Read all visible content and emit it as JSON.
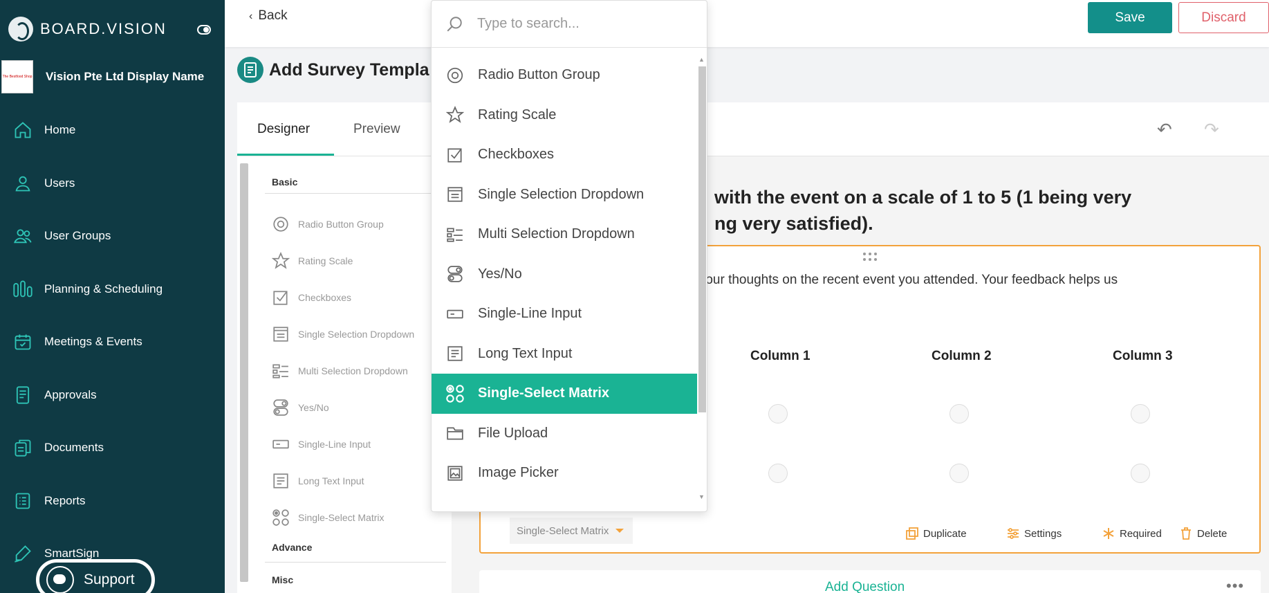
{
  "brand": {
    "name": "BOARD.VISION"
  },
  "organization": {
    "name": "Vision Pte Ltd Display Name",
    "logo_text": "The Bestfood Shop"
  },
  "sidebar": {
    "items": [
      {
        "label": "Home",
        "icon": "home-icon"
      },
      {
        "label": "Users",
        "icon": "user-icon"
      },
      {
        "label": "User Groups",
        "icon": "users-icon"
      },
      {
        "label": "Planning & Scheduling",
        "icon": "bars-icon"
      },
      {
        "label": "Meetings & Events",
        "icon": "calendar-icon"
      },
      {
        "label": "Approvals",
        "icon": "approval-doc-icon"
      },
      {
        "label": "Documents",
        "icon": "documents-icon"
      },
      {
        "label": "Reports",
        "icon": "report-icon"
      },
      {
        "label": "SmartSign",
        "icon": "pen-icon"
      }
    ],
    "support_label": "Support"
  },
  "toolbar": {
    "back_label": "Back",
    "save_label": "Save",
    "discard_label": "Discard"
  },
  "page": {
    "title": "Add Survey Templa"
  },
  "tabs": [
    {
      "label": "Designer"
    },
    {
      "label": "Preview"
    }
  ],
  "toolbox": {
    "basic_heading": "Basic",
    "advance_heading": "Advance",
    "misc_heading": "Misc",
    "items": [
      "Radio Button Group",
      "Rating Scale",
      "Checkboxes",
      "Single Selection Dropdown",
      "Multi Selection Dropdown",
      "Yes/No",
      "Single-Line Input",
      "Long Text Input",
      "Single-Select Matrix"
    ]
  },
  "question": {
    "title_line1": "with the event on a scale of 1 to 5 (1 being very",
    "title_line2": "ng very satisfied).",
    "description": "e your thoughts on the recent event you attended. Your feedback helps us",
    "columns": [
      "Column 1",
      "Column 2",
      "Column 3"
    ],
    "type_label": "Single-Select Matrix",
    "actions": {
      "duplicate": "Duplicate",
      "settings": "Settings",
      "required": "Required",
      "delete": "Delete"
    },
    "add_question_label": "Add Question",
    "more_label": "•••"
  },
  "dropdown": {
    "search_placeholder": "Type to search...",
    "items": [
      {
        "label": "Radio Button Group",
        "icon": "radio-icon"
      },
      {
        "label": "Rating Scale",
        "icon": "star-icon"
      },
      {
        "label": "Checkboxes",
        "icon": "checkbox-icon"
      },
      {
        "label": "Single Selection Dropdown",
        "icon": "dropdown-icon"
      },
      {
        "label": "Multi Selection Dropdown",
        "icon": "multi-dropdown-icon"
      },
      {
        "label": "Yes/No",
        "icon": "toggle-icon"
      },
      {
        "label": "Single-Line Input",
        "icon": "input-icon"
      },
      {
        "label": "Long Text Input",
        "icon": "textarea-icon"
      },
      {
        "label": "Single-Select Matrix",
        "icon": "matrix-icon"
      },
      {
        "label": "File Upload",
        "icon": "folder-icon"
      },
      {
        "label": "Image Picker",
        "icon": "image-icon"
      }
    ],
    "selected": "Single-Select Matrix"
  },
  "colors": {
    "sidebar": "#0f3a44",
    "accent": "#1ab394",
    "save": "#138f8a",
    "discard": "#e0606a",
    "highlight": "#f3a23b"
  }
}
